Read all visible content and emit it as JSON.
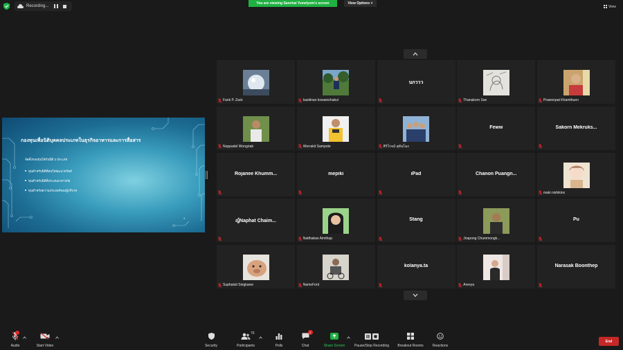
{
  "top_bar": {
    "recording_label": "Recording...",
    "viewing_banner": "You are viewing Sanchai Yeewlyom's screen",
    "view_options_label": "View Options ˅",
    "view_label": "View"
  },
  "slide": {
    "title": "กองทุนเพื่อนิติบุคคลประเภทในธุรกิจอาหารและการสื่อสาร",
    "subtitle": "จัดตั้งกองทุนได้กับนิติ 3 ประเภท",
    "bullets": [
      "ทุนสำหรับนิติที่สนใจพัฒนาทรัพย์",
      "ทุนสำหรับนิติที่ประสบอาสารภัย",
      "ทุนสำหรับความประสงค์ของผู้บริจาค"
    ],
    "page_number": "4"
  },
  "participants": [
    {
      "name": "Fank P. Zack",
      "display": "",
      "photo": "bubble"
    },
    {
      "name": "kasitinan kowanichakul",
      "display": "",
      "photo": "trees"
    },
    {
      "name": "",
      "display": "นกววว",
      "photo": ""
    },
    {
      "name": "Thanakorn San",
      "display": "",
      "photo": "sketch"
    },
    {
      "name": "Prawonpat Khamthuen",
      "display": "",
      "photo": "kid"
    },
    {
      "name": "Noppadol Wongriab",
      "display": "",
      "photo": "man"
    },
    {
      "name": "Worrakit Sampote",
      "display": "",
      "photo": "yellow"
    },
    {
      "name": "ศิวิโรจน์ สุดันโมง",
      "display": "",
      "photo": "group"
    },
    {
      "name": "",
      "display": "Feww",
      "photo": ""
    },
    {
      "name": "",
      "display": "Sakorn  Mekruks...",
      "photo": ""
    },
    {
      "name": "",
      "display": "Rojanee  Khumm...",
      "photo": ""
    },
    {
      "name": "",
      "display": "mepiki",
      "photo": ""
    },
    {
      "name": "",
      "display": "iPad",
      "photo": ""
    },
    {
      "name": "",
      "display": "Chanon  Puangn...",
      "photo": ""
    },
    {
      "name": "maki nishikino",
      "display": "",
      "photo": "anime"
    },
    {
      "name": "",
      "display": "ญ์Naphat  Chaim...",
      "photo": ""
    },
    {
      "name": "Natthakan Aimthap",
      "display": "",
      "photo": "girl"
    },
    {
      "name": "",
      "display": "Stang",
      "photo": ""
    },
    {
      "name": "Jirapong Chummongk...",
      "display": "",
      "photo": "man2"
    },
    {
      "name": "",
      "display": "Pu",
      "photo": ""
    },
    {
      "name": "Suphatsit Singkaew",
      "display": "",
      "photo": "dog"
    },
    {
      "name": "NameFord",
      "display": "",
      "photo": "bike"
    },
    {
      "name": "",
      "display": "kolanya.ta",
      "photo": ""
    },
    {
      "name": "Areeya",
      "display": "",
      "photo": "room"
    },
    {
      "name": "",
      "display": "Narasak Boonthep",
      "photo": ""
    }
  ],
  "toolbar": {
    "audio": "Audio",
    "start_video": "Start Video",
    "security": "Security",
    "participants": "Participants",
    "participants_count": "76",
    "polls": "Polls",
    "chat": "Chat",
    "chat_badge": "2",
    "share_screen": "Share Screen",
    "pause_stop_recording": "Pause/Stop Recording",
    "breakout_rooms": "Breakout Rooms",
    "reactions": "Reactions",
    "end": "End"
  },
  "colors": {
    "background": "#1a1a1a",
    "tile": "#222222",
    "banner_green": "#1fb141",
    "muted_red": "#e02828",
    "end_red": "#c62828"
  }
}
